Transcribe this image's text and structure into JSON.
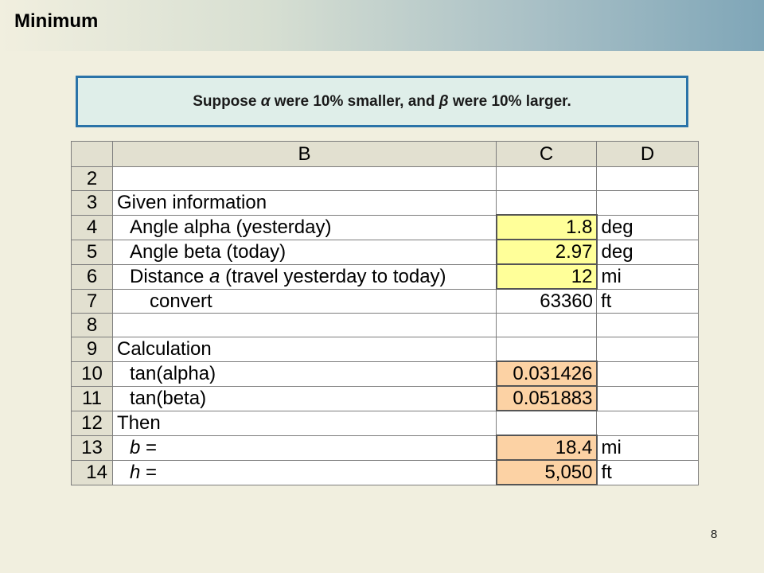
{
  "slide": {
    "title": "Minimum",
    "page_number": "8"
  },
  "callout": {
    "text_before_alpha": "Suppose ",
    "alpha_symbol": "α",
    "text_middle": " were 10% smaller, and ",
    "beta_symbol": "β",
    "text_after_beta": " were 10% larger."
  },
  "sheet": {
    "headers": [
      "B",
      "C",
      "D"
    ],
    "rows": [
      {
        "num": "2",
        "b": "",
        "c": "",
        "d": "",
        "c_style": "plain"
      },
      {
        "num": "3",
        "b": "Given information",
        "c": "",
        "d": "",
        "c_style": "plain"
      },
      {
        "num": "4",
        "b": "Angle alpha (yesterday)",
        "c": "1.8",
        "d": "deg",
        "c_style": "yellow"
      },
      {
        "num": "5",
        "b": "Angle beta (today)",
        "c": "2.97",
        "d": "deg",
        "c_style": "yellow"
      },
      {
        "num": "6",
        "b_prefix": "Distance ",
        "b_var": "a",
        "b_suffix": " (travel yesterday to today)",
        "c": "12",
        "d": "mi",
        "c_style": "yellow"
      },
      {
        "num": "7",
        "b": "convert",
        "c": "63360",
        "d": "ft",
        "c_style": "plain"
      },
      {
        "num": "8",
        "b": "",
        "c": "",
        "d": "",
        "c_style": "plain"
      },
      {
        "num": "9",
        "b": "Calculation",
        "c": "",
        "d": "",
        "c_style": "plain"
      },
      {
        "num": "10",
        "b": "tan(alpha)",
        "c": "0.031426",
        "d": "",
        "c_style": "orange"
      },
      {
        "num": "11",
        "b": "tan(beta)",
        "c": "0.051883",
        "d": "",
        "c_style": "orange"
      },
      {
        "num": "12",
        "b": "Then",
        "c": "",
        "d": "",
        "c_style": "plain"
      },
      {
        "num": "13",
        "b_var": "b",
        "b_suffix": " =",
        "c": "18.4",
        "d": "mi",
        "c_style": "orange"
      },
      {
        "num": "14",
        "b_var": "h",
        "b_suffix": " =",
        "c": "5,050",
        "d": "ft",
        "c_style": "orange"
      }
    ]
  },
  "colors": {
    "input_cell": "#ffff99",
    "output_cell": "#fcd2a4",
    "callout_border": "#2a73a8",
    "background": "#f1efdf"
  }
}
